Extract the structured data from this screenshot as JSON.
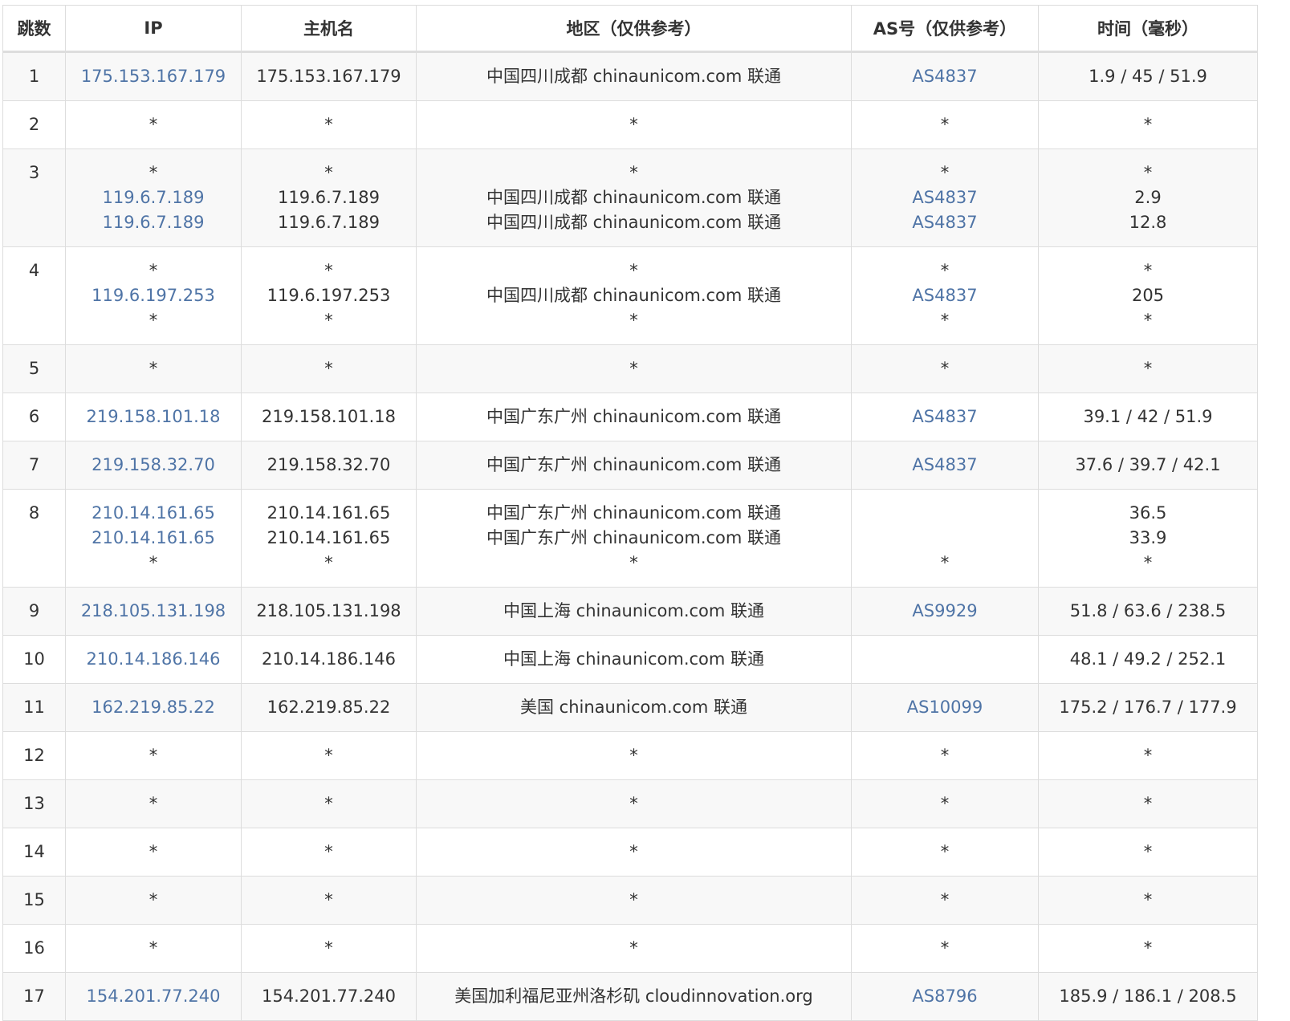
{
  "table": {
    "headers": [
      "跳数",
      "IP",
      "主机名",
      "地区（仅供参考）",
      "AS号（仅供参考）",
      "时间（毫秒）"
    ],
    "rows": [
      {
        "hop": "1",
        "ip": [
          "175.153.167.179"
        ],
        "host": [
          "175.153.167.179"
        ],
        "region": [
          "中国四川成都 chinaunicom.com 联通"
        ],
        "as": [
          "AS4837"
        ],
        "time": [
          "1.9 / 45 / 51.9"
        ]
      },
      {
        "hop": "2",
        "ip": [
          "*"
        ],
        "host": [
          "*"
        ],
        "region": [
          "*"
        ],
        "as": [
          "*"
        ],
        "time": [
          "*"
        ]
      },
      {
        "hop": "3",
        "ip": [
          "*",
          "119.6.7.189",
          "119.6.7.189"
        ],
        "host": [
          "*",
          "119.6.7.189",
          "119.6.7.189"
        ],
        "region": [
          "*",
          "中国四川成都 chinaunicom.com 联通",
          "中国四川成都 chinaunicom.com 联通"
        ],
        "as": [
          "*",
          "AS4837",
          "AS4837"
        ],
        "time": [
          "*",
          "2.9",
          "12.8"
        ]
      },
      {
        "hop": "4",
        "ip": [
          "*",
          "119.6.197.253",
          "*"
        ],
        "host": [
          "*",
          "119.6.197.253",
          "*"
        ],
        "region": [
          "*",
          "中国四川成都 chinaunicom.com 联通",
          "*"
        ],
        "as": [
          "*",
          "AS4837",
          "*"
        ],
        "time": [
          "*",
          "205",
          "*"
        ]
      },
      {
        "hop": "5",
        "ip": [
          "*"
        ],
        "host": [
          "*"
        ],
        "region": [
          "*"
        ],
        "as": [
          "*"
        ],
        "time": [
          "*"
        ]
      },
      {
        "hop": "6",
        "ip": [
          "219.158.101.18"
        ],
        "host": [
          "219.158.101.18"
        ],
        "region": [
          "中国广东广州 chinaunicom.com 联通"
        ],
        "as": [
          "AS4837"
        ],
        "time": [
          "39.1 / 42 / 51.9"
        ]
      },
      {
        "hop": "7",
        "ip": [
          "219.158.32.70"
        ],
        "host": [
          "219.158.32.70"
        ],
        "region": [
          "中国广东广州 chinaunicom.com 联通"
        ],
        "as": [
          "AS4837"
        ],
        "time": [
          "37.6 / 39.7 / 42.1"
        ]
      },
      {
        "hop": "8",
        "ip": [
          "210.14.161.65",
          "210.14.161.65",
          "*"
        ],
        "host": [
          "210.14.161.65",
          "210.14.161.65",
          "*"
        ],
        "region": [
          "中国广东广州 chinaunicom.com 联通",
          "中国广东广州 chinaunicom.com 联通",
          "*"
        ],
        "as": [
          "",
          "",
          "*"
        ],
        "time": [
          "36.5",
          "33.9",
          "*"
        ]
      },
      {
        "hop": "9",
        "ip": [
          "218.105.131.198"
        ],
        "host": [
          "218.105.131.198"
        ],
        "region": [
          "中国上海 chinaunicom.com 联通"
        ],
        "as": [
          "AS9929"
        ],
        "time": [
          "51.8 / 63.6 / 238.5"
        ]
      },
      {
        "hop": "10",
        "ip": [
          "210.14.186.146"
        ],
        "host": [
          "210.14.186.146"
        ],
        "region": [
          "中国上海 chinaunicom.com 联通"
        ],
        "as": [
          ""
        ],
        "time": [
          "48.1 / 49.2 / 252.1"
        ]
      },
      {
        "hop": "11",
        "ip": [
          "162.219.85.22"
        ],
        "host": [
          "162.219.85.22"
        ],
        "region": [
          "美国 chinaunicom.com 联通"
        ],
        "as": [
          "AS10099"
        ],
        "time": [
          "175.2 / 176.7 / 177.9"
        ]
      },
      {
        "hop": "12",
        "ip": [
          "*"
        ],
        "host": [
          "*"
        ],
        "region": [
          "*"
        ],
        "as": [
          "*"
        ],
        "time": [
          "*"
        ]
      },
      {
        "hop": "13",
        "ip": [
          "*"
        ],
        "host": [
          "*"
        ],
        "region": [
          "*"
        ],
        "as": [
          "*"
        ],
        "time": [
          "*"
        ]
      },
      {
        "hop": "14",
        "ip": [
          "*"
        ],
        "host": [
          "*"
        ],
        "region": [
          "*"
        ],
        "as": [
          "*"
        ],
        "time": [
          "*"
        ]
      },
      {
        "hop": "15",
        "ip": [
          "*"
        ],
        "host": [
          "*"
        ],
        "region": [
          "*"
        ],
        "as": [
          "*"
        ],
        "time": [
          "*"
        ]
      },
      {
        "hop": "16",
        "ip": [
          "*"
        ],
        "host": [
          "*"
        ],
        "region": [
          "*"
        ],
        "as": [
          "*"
        ],
        "time": [
          "*"
        ]
      },
      {
        "hop": "17",
        "ip": [
          "154.201.77.240"
        ],
        "host": [
          "154.201.77.240"
        ],
        "region": [
          "美国加利福尼亚州洛杉矶 cloudinnovation.org"
        ],
        "as": [
          "AS8796"
        ],
        "time": [
          "185.9 / 186.1 / 208.5"
        ]
      }
    ]
  },
  "colors": {
    "link": "#4f74a6",
    "text": "#333333",
    "border": "#dddddd",
    "stripe": "#f8f8f8"
  }
}
